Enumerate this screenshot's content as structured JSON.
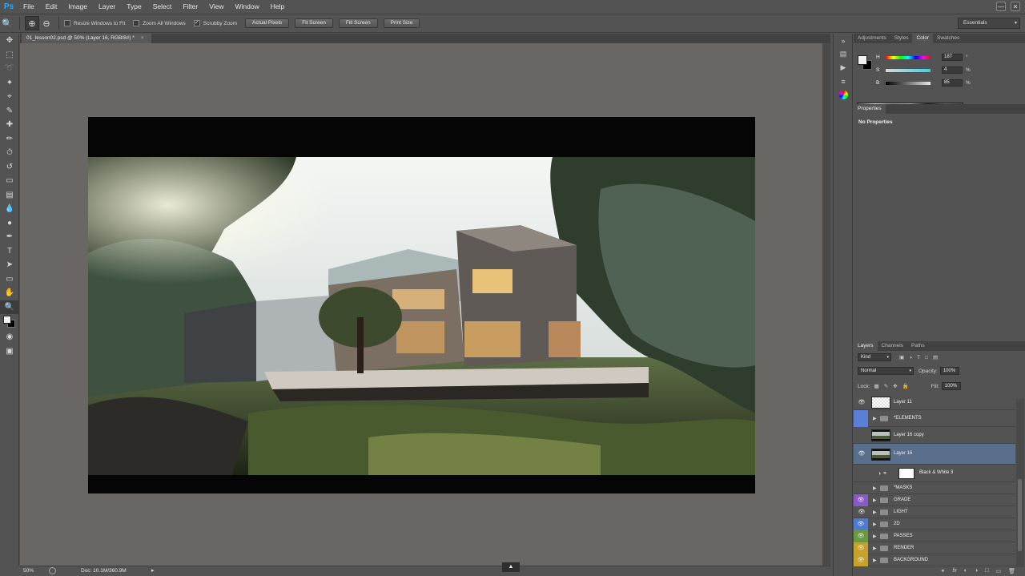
{
  "app": {
    "logo": "Ps"
  },
  "menu": [
    "File",
    "Edit",
    "Image",
    "Layer",
    "Type",
    "Select",
    "Filter",
    "View",
    "Window",
    "Help"
  ],
  "window_controls": {
    "minimize": "—",
    "close": "✕"
  },
  "options_bar": {
    "resize_windows": {
      "label": "Resize Windows to Fit",
      "checked": false
    },
    "zoom_all": {
      "label": "Zoom All Windows",
      "checked": false
    },
    "scrubby_zoom": {
      "label": "Scrubby Zoom",
      "checked": true
    },
    "buttons": [
      "Actual Pixels",
      "Fit Screen",
      "Fill Screen",
      "Print Size"
    ],
    "workspace": "Essentials"
  },
  "document": {
    "tab_title": "01_lesson02.psd @ 50% (Layer 16, RGB/8#) *",
    "zoom": "50%",
    "doc_size": "Doc: 10.1M/360.9M"
  },
  "color_panel": {
    "tabs": [
      "Adjustments",
      "Styles",
      "Color",
      "Swatches"
    ],
    "active_tab": "Color",
    "sliders": [
      {
        "label": "H",
        "value": "187",
        "unit": "°"
      },
      {
        "label": "S",
        "value": "4",
        "unit": "%"
      },
      {
        "label": "B",
        "value": "85",
        "unit": "%"
      }
    ]
  },
  "properties_panel": {
    "title": "Properties",
    "message": "No Properties"
  },
  "layers_panel": {
    "tabs": [
      "Layers",
      "Channels",
      "Paths"
    ],
    "filter": "Kind",
    "blend_mode": "Normal",
    "opacity_label": "Opacity:",
    "opacity": "100%",
    "lock_label": "Lock:",
    "fill_label": "Fill:",
    "fill": "100%",
    "layers": [
      {
        "name": "Layer 11",
        "kind": "layer",
        "visible": true,
        "eye_color": "",
        "thumb": "checker"
      },
      {
        "name": "*ELEMENTS",
        "kind": "group",
        "visible": false,
        "eye_color": "#5b7fd6"
      },
      {
        "name": "Layer 16 copy",
        "kind": "layer",
        "visible": false,
        "eye_color": "",
        "thumb": "image"
      },
      {
        "name": "Layer 16",
        "kind": "layer",
        "visible": true,
        "eye_color": "",
        "thumb": "image",
        "selected": true
      },
      {
        "name": "Black & White 3",
        "kind": "adjustment",
        "visible": false,
        "eye_color": "",
        "thumb": "white"
      },
      {
        "name": "*MASKS",
        "kind": "group",
        "visible": false,
        "eye_color": ""
      },
      {
        "name": "GRADE",
        "kind": "group",
        "visible": true,
        "eye_color": "#8a5bc4"
      },
      {
        "name": "LIGHT",
        "kind": "group",
        "visible": true,
        "eye_color": ""
      },
      {
        "name": "2D",
        "kind": "group",
        "visible": true,
        "eye_color": "#4e7bd0"
      },
      {
        "name": "PASSES",
        "kind": "group",
        "visible": true,
        "eye_color": "#6a9a3e"
      },
      {
        "name": "RENDER",
        "kind": "group",
        "visible": true,
        "eye_color": "#c8a12a"
      },
      {
        "name": "BACKGROUND",
        "kind": "group",
        "visible": true,
        "eye_color": "#c8a12a"
      }
    ],
    "footer_icons": [
      "link-icon",
      "fx-icon",
      "mask-icon",
      "adjustment-icon",
      "group-icon",
      "new-layer-icon",
      "trash-icon"
    ]
  }
}
